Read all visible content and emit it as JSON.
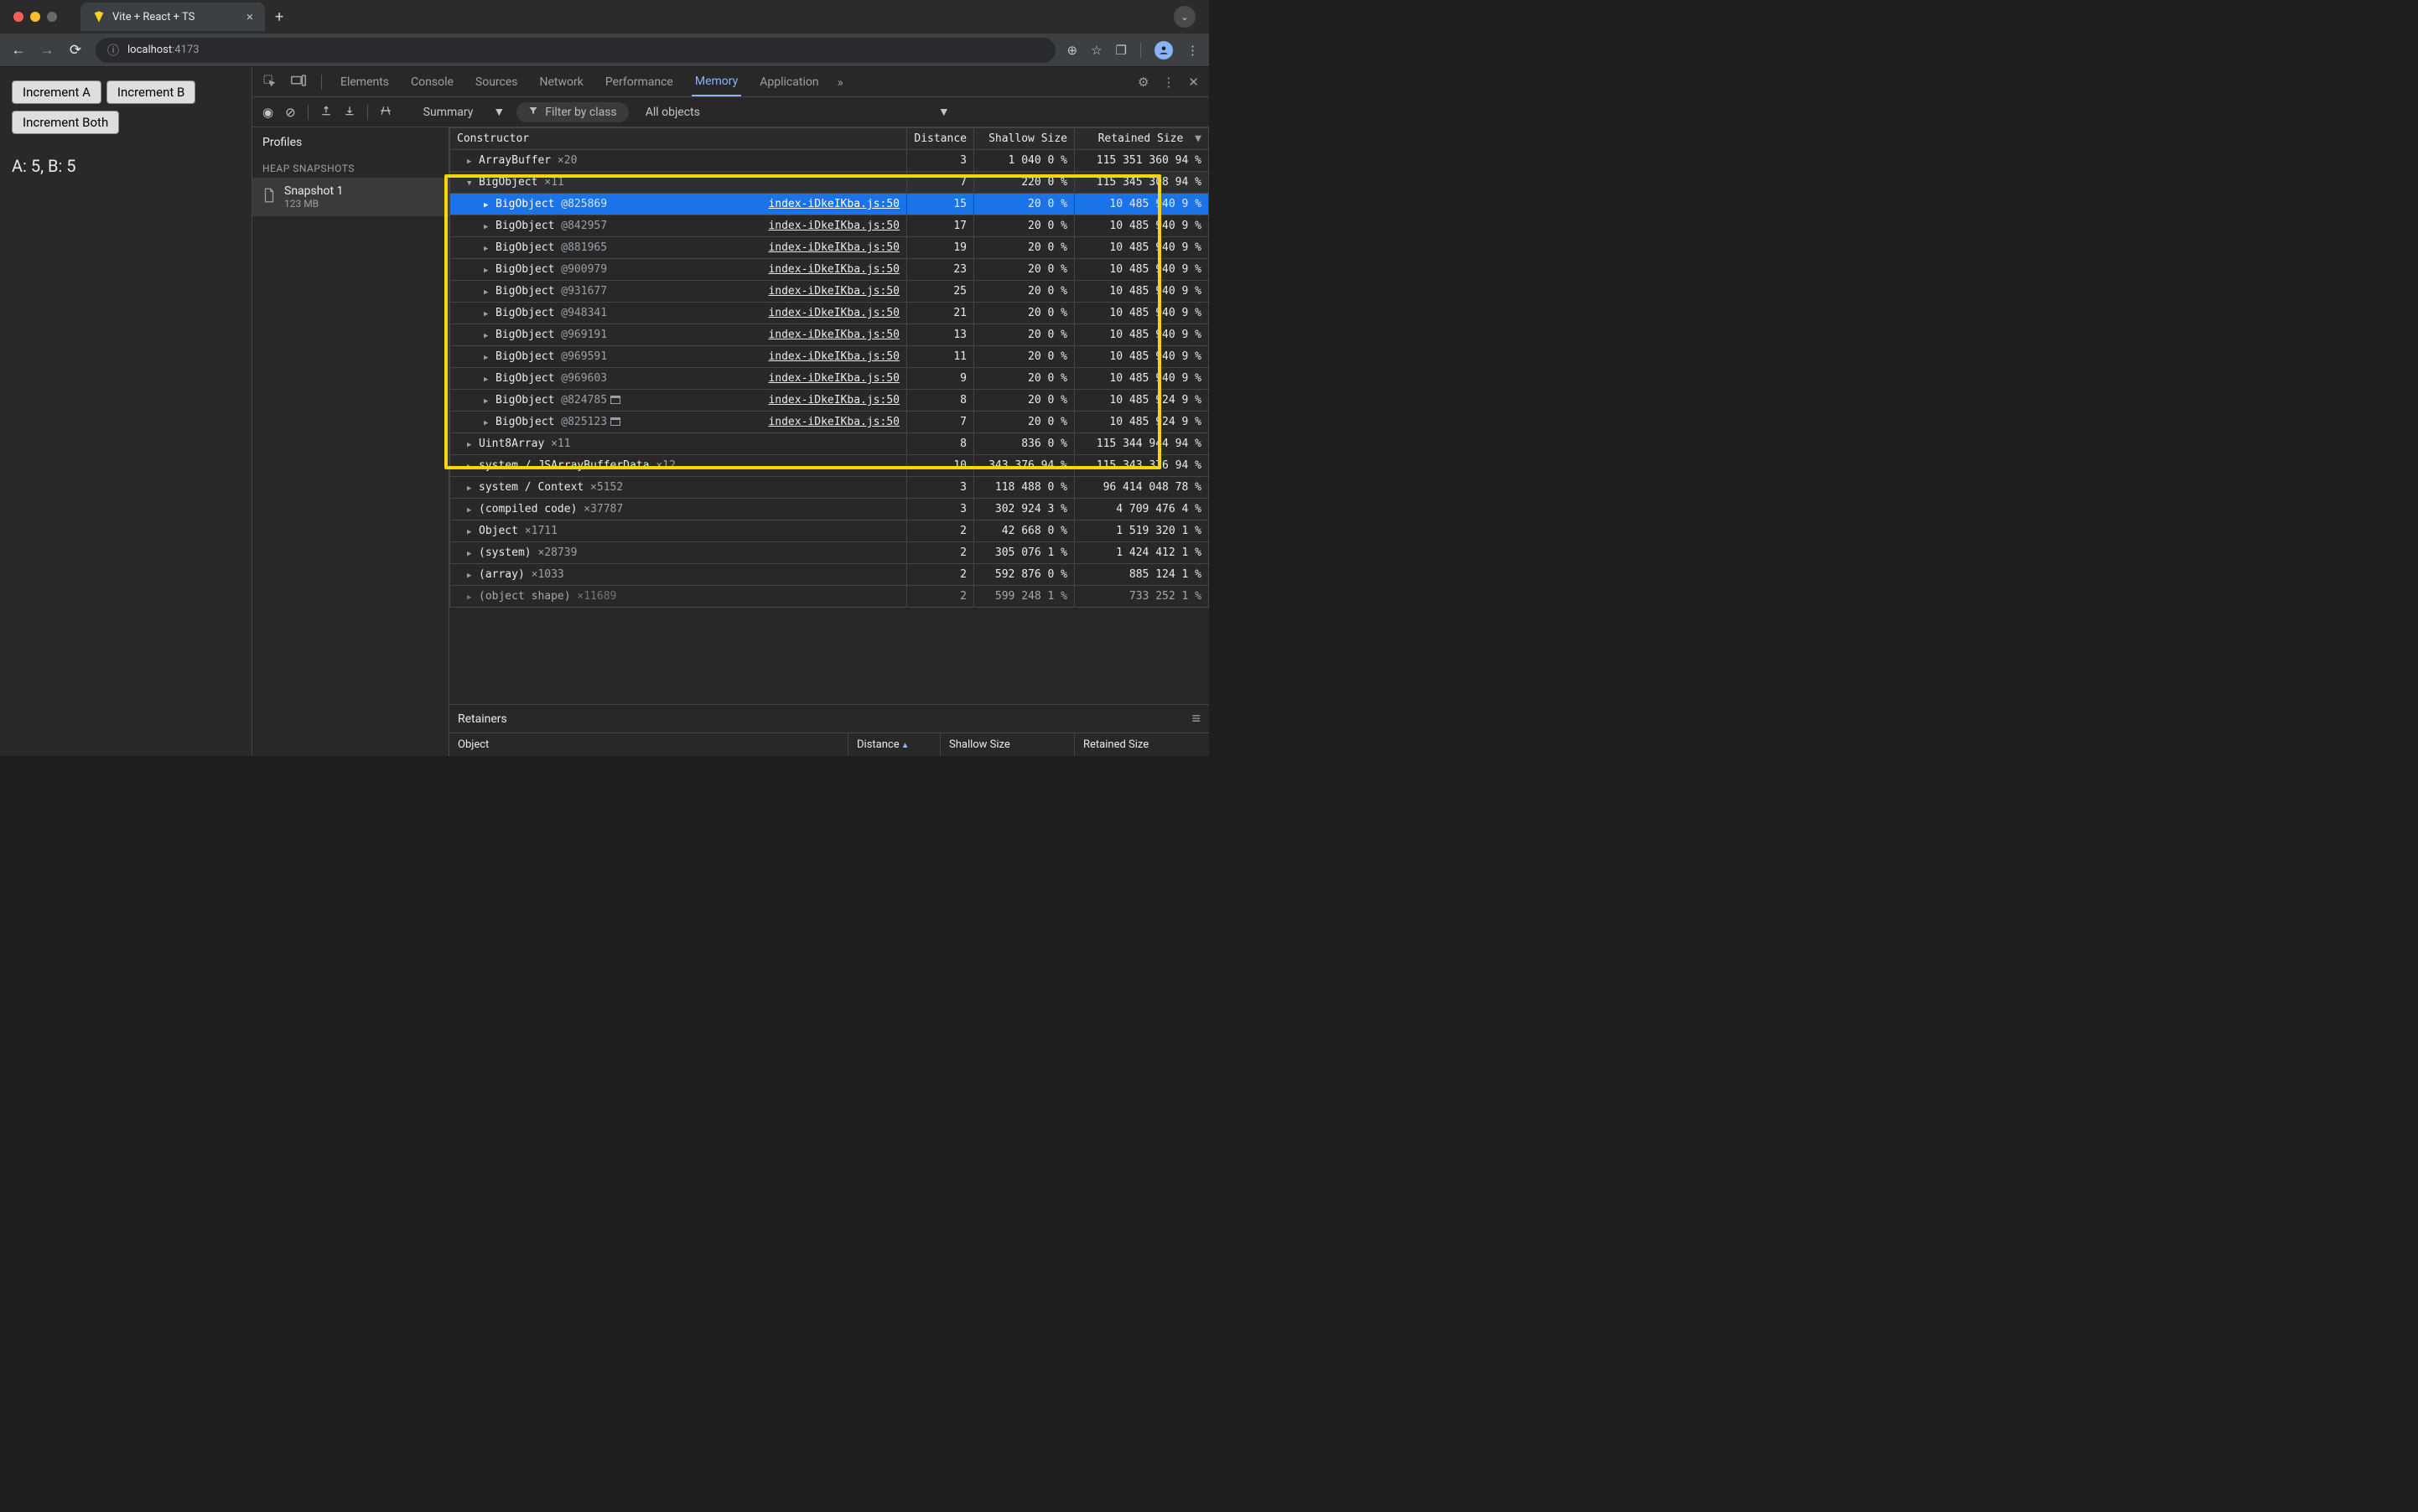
{
  "window": {
    "tab_title": "Vite + React + TS"
  },
  "url": {
    "host": "localhost",
    "port": ":4173"
  },
  "page": {
    "btn_a": "Increment A",
    "btn_b": "Increment B",
    "btn_both": "Increment Both",
    "counts": "A: 5, B: 5"
  },
  "devtools": {
    "tabs": {
      "elements": "Elements",
      "console": "Console",
      "sources": "Sources",
      "network": "Network",
      "performance": "Performance",
      "memory": "Memory",
      "application": "Application"
    },
    "toolbar": {
      "summary": "Summary",
      "filter_placeholder": "Filter by class",
      "all_objects": "All objects"
    },
    "profiles": {
      "title": "Profiles",
      "heap_label": "HEAP SNAPSHOTS",
      "snapshot_name": "Snapshot 1",
      "snapshot_size": "123 MB"
    },
    "columns": {
      "constructor": "Constructor",
      "distance": "Distance",
      "shallow": "Shallow Size",
      "retained": "Retained Size"
    },
    "retainers": {
      "title": "Retainers",
      "object": "Object",
      "distance": "Distance",
      "shallow": "Shallow Size",
      "retained": "Retained Size"
    },
    "src_link": "index-iDkeIKba.js:50",
    "rows": [
      {
        "type": "group",
        "name": "ArrayBuffer",
        "count": "×20",
        "indent": 1,
        "tri": "closed",
        "dist": "3",
        "shallow": "1 040",
        "shallow_pct": "0 %",
        "retained": "115 351 360",
        "retained_pct": "94 %"
      },
      {
        "type": "group",
        "name": "BigObject",
        "count": "×11",
        "indent": 1,
        "tri": "open",
        "dist": "7",
        "shallow": "220",
        "shallow_pct": "0 %",
        "retained": "115 345 308",
        "retained_pct": "94 %",
        "shaded": true
      },
      {
        "type": "obj",
        "name": "BigObject",
        "id": "@825869",
        "indent": 2,
        "selected": true,
        "dist": "15",
        "shallow": "20",
        "shallow_pct": "0 %",
        "retained": "10 485 940",
        "retained_pct": "9 %"
      },
      {
        "type": "obj",
        "name": "BigObject",
        "id": "@842957",
        "indent": 2,
        "dist": "17",
        "shallow": "20",
        "shallow_pct": "0 %",
        "retained": "10 485 940",
        "retained_pct": "9 %"
      },
      {
        "type": "obj",
        "name": "BigObject",
        "id": "@881965",
        "indent": 2,
        "dist": "19",
        "shallow": "20",
        "shallow_pct": "0 %",
        "retained": "10 485 940",
        "retained_pct": "9 %"
      },
      {
        "type": "obj",
        "name": "BigObject",
        "id": "@900979",
        "indent": 2,
        "dist": "23",
        "shallow": "20",
        "shallow_pct": "0 %",
        "retained": "10 485 940",
        "retained_pct": "9 %"
      },
      {
        "type": "obj",
        "name": "BigObject",
        "id": "@931677",
        "indent": 2,
        "dist": "25",
        "shallow": "20",
        "shallow_pct": "0 %",
        "retained": "10 485 940",
        "retained_pct": "9 %"
      },
      {
        "type": "obj",
        "name": "BigObject",
        "id": "@948341",
        "indent": 2,
        "dist": "21",
        "shallow": "20",
        "shallow_pct": "0 %",
        "retained": "10 485 940",
        "retained_pct": "9 %"
      },
      {
        "type": "obj",
        "name": "BigObject",
        "id": "@969191",
        "indent": 2,
        "dist": "13",
        "shallow": "20",
        "shallow_pct": "0 %",
        "retained": "10 485 940",
        "retained_pct": "9 %"
      },
      {
        "type": "obj",
        "name": "BigObject",
        "id": "@969591",
        "indent": 2,
        "dist": "11",
        "shallow": "20",
        "shallow_pct": "0 %",
        "retained": "10 485 940",
        "retained_pct": "9 %"
      },
      {
        "type": "obj",
        "name": "BigObject",
        "id": "@969603",
        "indent": 2,
        "dist": "9",
        "shallow": "20",
        "shallow_pct": "0 %",
        "retained": "10 485 940",
        "retained_pct": "9 %"
      },
      {
        "type": "obj",
        "name": "BigObject",
        "id": "@824785",
        "indent": 2,
        "detached": true,
        "dist": "8",
        "shallow": "20",
        "shallow_pct": "0 %",
        "retained": "10 485 924",
        "retained_pct": "9 %"
      },
      {
        "type": "obj",
        "name": "BigObject",
        "id": "@825123",
        "indent": 2,
        "detached": true,
        "dist": "7",
        "shallow": "20",
        "shallow_pct": "0 %",
        "retained": "10 485 924",
        "retained_pct": "9 %"
      },
      {
        "type": "group",
        "name": "Uint8Array",
        "count": "×11",
        "indent": 1,
        "tri": "closed",
        "dist": "8",
        "shallow": "836",
        "shallow_pct": "0 %",
        "retained": "115 344 944",
        "retained_pct": "94 %"
      },
      {
        "type": "group",
        "name": "system / JSArrayBufferData",
        "count": "×12",
        "indent": 1,
        "tri": "closed",
        "dist": "10",
        "shallow": "343 376",
        "shallow_pct": "94 %",
        "retained": "115 343 376",
        "retained_pct": "94 %",
        "clip_shallow": true
      },
      {
        "type": "group",
        "name": "system / Context",
        "count": "×5152",
        "indent": 1,
        "tri": "closed",
        "dist": "3",
        "shallow": "118 488",
        "shallow_pct": "0 %",
        "retained": "96 414 048",
        "retained_pct": "78 %",
        "clip_shallow": true
      },
      {
        "type": "group",
        "name": "(compiled code)",
        "count": "×37787",
        "indent": 1,
        "tri": "closed",
        "dist": "3",
        "shallow": "302 924",
        "shallow_pct": "3 %",
        "retained": "4 709 476",
        "retained_pct": "4 %",
        "clip_shallow": true
      },
      {
        "type": "group",
        "name": "Object",
        "count": "×1711",
        "indent": 1,
        "tri": "closed",
        "dist": "2",
        "shallow": "42 668",
        "shallow_pct": "0 %",
        "retained": "1 519 320",
        "retained_pct": "1 %",
        "clip_shallow": true
      },
      {
        "type": "group",
        "name": "(system)",
        "count": "×28739",
        "indent": 1,
        "tri": "closed",
        "dist": "2",
        "shallow": "305 076",
        "shallow_pct": "1 %",
        "retained": "1 424 412",
        "retained_pct": "1 %",
        "clip_shallow": true
      },
      {
        "type": "group",
        "name": "(array)",
        "count": "×1033",
        "indent": 1,
        "tri": "closed",
        "dist": "2",
        "shallow": "592 876",
        "shallow_pct": "0 %",
        "retained": "885 124",
        "retained_pct": "1 %",
        "clip_shallow": true
      },
      {
        "type": "group",
        "name": "(object shape)",
        "count": "×11689",
        "indent": 1,
        "tri": "closed",
        "dist": "2",
        "shallow": "599 248",
        "shallow_pct": "1 %",
        "retained": "733 252",
        "retained_pct": "1 %",
        "clip_shallow": true,
        "faded": true
      }
    ]
  }
}
